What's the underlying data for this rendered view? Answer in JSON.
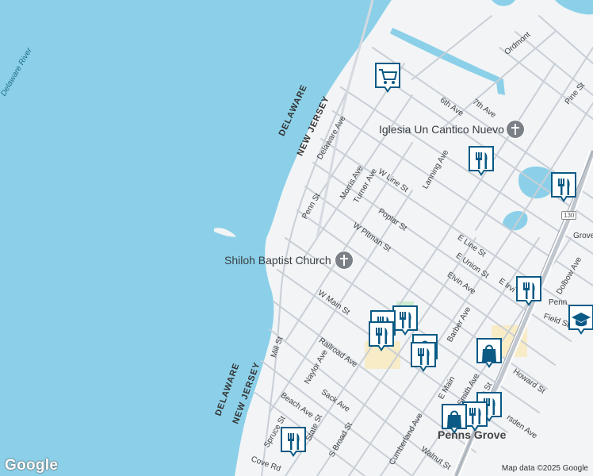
{
  "colors": {
    "water": "#8bd0e8",
    "land": "#f2f4f6",
    "road": "#c5cbd3",
    "marker_border": "#0a5a85",
    "marker_fill": "#ffffff",
    "icon": "#0a5a85"
  },
  "labels": {
    "delaware_river": "Delaware River",
    "delaware_upper": "DELAWARE",
    "new_jersey_upper": "NEW JERSEY",
    "delaware_lower": "DELAWARE",
    "new_jersey_lower": "NEW JERSEY",
    "iglesia": "Iglesia Un Cantico Nuevo",
    "shiloh": "Shiloh Baptist Church",
    "penns_grove": "Penns Grove",
    "route_130": "130"
  },
  "streets": {
    "ordmont": "Ordmont",
    "sixth_ave": "6th Ave",
    "seventh_ave": "7th Ave",
    "pine_st": "Pine St",
    "delaware_ave": "Delaware Ave",
    "morris_ave": "Morris Ave",
    "w_line_st": "W Line St",
    "turner_ave": "Turner Ave",
    "lanning_ave": "Lanning Ave",
    "penn_st": "Penn St",
    "poplar_st": "Poplar St",
    "w_pitman_st": "W Pitman St",
    "e_line_st": "E Line St",
    "e_union_st": "E Union St",
    "elvin_ave": "Elvin Ave",
    "e_irvi": "E Irvi",
    "penn": "Penn",
    "grove": "Grove",
    "dolbow_ave": "Dolbow Ave",
    "field_st": "Field St",
    "w_main_st": "W Main St",
    "barber_ave": "Barber Ave",
    "railroad_ave": "Railroad Ave",
    "mill_st": "Mill St",
    "naylor_ave": "Naylor Ave",
    "howard_st": "Howard St",
    "beach_ave": "Beach Ave",
    "sack_ave": "Sack Ave",
    "e_main": "E Main",
    "smith_ave": "Smith Ave",
    "harrison": "rrison St",
    "marsden_ave": "rsden Ave",
    "spruce_st": "Spruce St",
    "state_st": "State St",
    "s_broad_st": "S Broad St",
    "cumberland_ave": "Cumberland Ave",
    "walnut_st": "Walnut St",
    "cove_rd": "Cove Rd"
  },
  "markers": [
    {
      "name": "grocery-marker",
      "icon": "cart"
    },
    {
      "name": "restaurant-marker-lanning",
      "icon": "fork-knife"
    },
    {
      "name": "restaurant-marker-east",
      "icon": "fork-knife"
    },
    {
      "name": "restaurant-marker-elvin",
      "icon": "fork-knife"
    },
    {
      "name": "school-marker",
      "icon": "graduation-cap"
    },
    {
      "name": "restaurant-marker-main-1",
      "icon": "fork-knife"
    },
    {
      "name": "restaurant-marker-main-2",
      "icon": "fork-knife"
    },
    {
      "name": "restaurant-marker-main-3",
      "icon": "fork-knife"
    },
    {
      "name": "shopping-marker-railroad",
      "icon": "shopping-bag"
    },
    {
      "name": "restaurant-marker-railroad",
      "icon": "fork-knife"
    },
    {
      "name": "shopping-marker-howard",
      "icon": "shopping-bag"
    },
    {
      "name": "restaurant-marker-smith-1",
      "icon": "fork-knife"
    },
    {
      "name": "restaurant-marker-smith-2",
      "icon": "fork-knife"
    },
    {
      "name": "shopping-marker-penns-grove",
      "icon": "shopping-bag"
    },
    {
      "name": "restaurant-marker-state",
      "icon": "fork-knife"
    }
  ],
  "footer": {
    "logo": "Google",
    "attribution": "Map data ©2025 Google"
  }
}
